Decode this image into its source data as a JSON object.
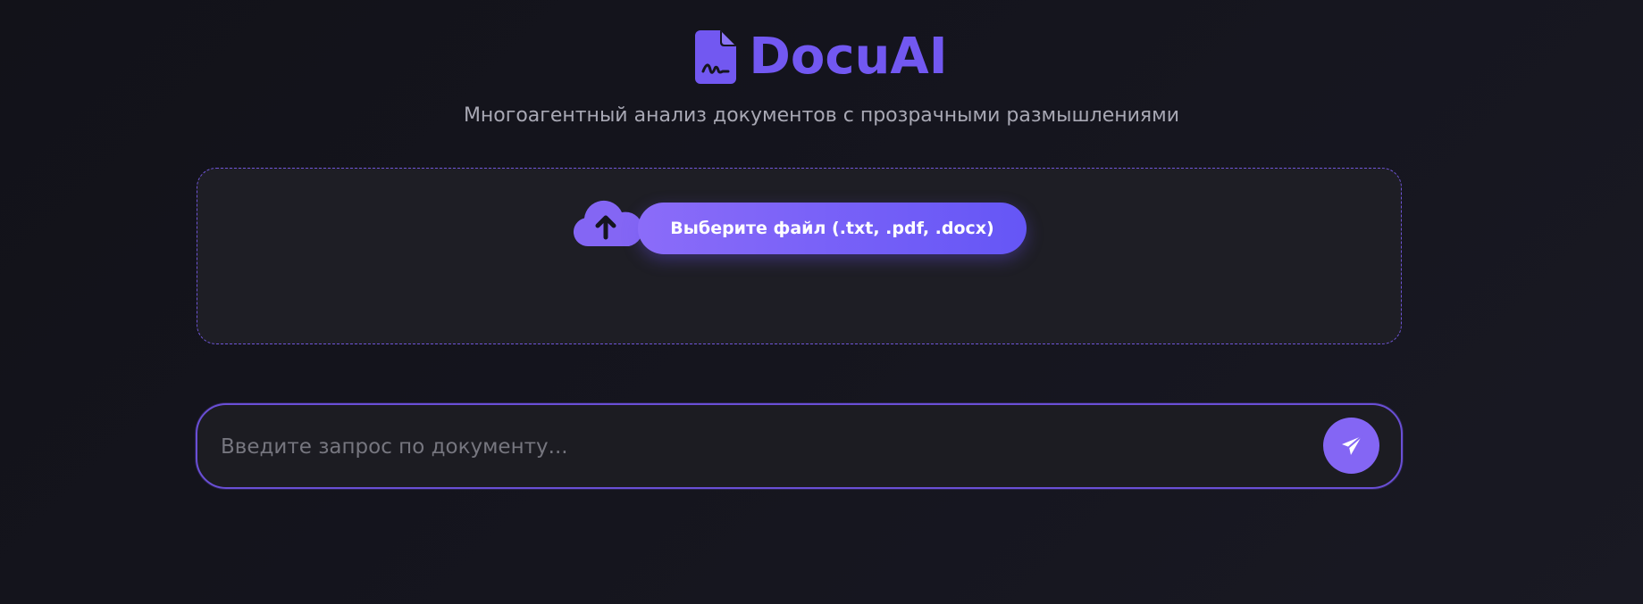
{
  "header": {
    "title": "DocuAI",
    "subtitle": "Многоагентный анализ документов с прозрачными размышлениями",
    "logo_icon": "file-signature-icon"
  },
  "upload": {
    "icon": "cloud-upload-icon",
    "button_label": "Выберите файл (.txt, .pdf, .docx)"
  },
  "query": {
    "value": "",
    "placeholder": "Введите запрос по документу...",
    "send_icon": "paper-plane-icon"
  },
  "colors": {
    "accent": "#7258f1",
    "button_gradient_start": "#8b6cf9",
    "button_gradient_end": "#6556f6",
    "background": "#15151e",
    "panel": "#1e1e25",
    "subtitle": "#a8a8b4"
  }
}
